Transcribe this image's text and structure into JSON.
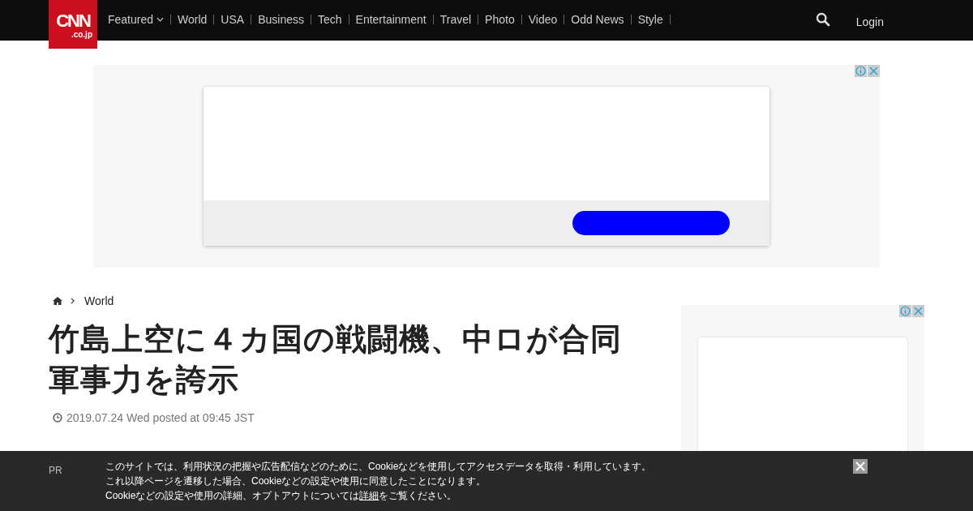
{
  "header": {
    "logo": {
      "main": "CNN",
      "sub": ".co.jp"
    },
    "nav": [
      {
        "label": "Featured",
        "dropdown": true
      },
      {
        "label": "World",
        "dropdown": false
      },
      {
        "label": "USA",
        "dropdown": false
      },
      {
        "label": "Business",
        "dropdown": false
      },
      {
        "label": "Tech",
        "dropdown": false
      },
      {
        "label": "Entertainment",
        "dropdown": false
      },
      {
        "label": "Travel",
        "dropdown": false
      },
      {
        "label": "Photo",
        "dropdown": false
      },
      {
        "label": "Video",
        "dropdown": false
      },
      {
        "label": "Odd News",
        "dropdown": false
      },
      {
        "label": "Style",
        "dropdown": false
      }
    ],
    "login": "Login"
  },
  "breadcrumb": [
    {
      "label": "World"
    }
  ],
  "article": {
    "title": "竹島上空に４カ国の戦闘機、中ロが合同軍事力を誇示",
    "date": "2019.07.24 Wed posted at 09:45 JST",
    "pr_label": "PR"
  },
  "cookie_banner": {
    "lines": [
      "このサイトでは、利用状況の把握や広告配信などのために、Cookieなどを使用してアクセスデータを取得・利用しています。",
      "これ以降ページを遷移した場合、Cookieなどの設定や使用に同意したことになります。"
    ],
    "last_line": {
      "before": "Cookieなどの設定や使用の詳細、オプトアウトについては",
      "link": "詳細",
      "after": "をご覧ください。"
    }
  }
}
